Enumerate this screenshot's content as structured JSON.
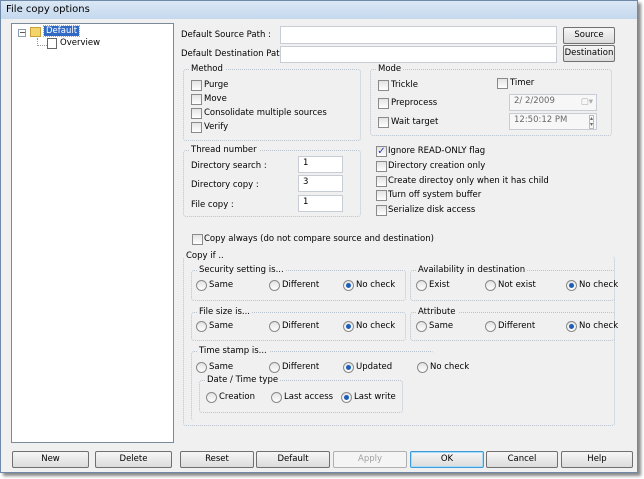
{
  "window": {
    "title": "File copy options"
  },
  "tree": {
    "root": "Default",
    "child": "Overview"
  },
  "paths": {
    "source_label": "Default Source Path :",
    "source_value": "",
    "source_button": "Source",
    "dest_label": "Default Destination Path :",
    "dest_value": "",
    "dest_button": "Destination"
  },
  "method": {
    "title": "Method",
    "items": [
      {
        "label": "Purge",
        "checked": false
      },
      {
        "label": "Move",
        "checked": false
      },
      {
        "label": "Consolidate multiple sources",
        "checked": false
      },
      {
        "label": "Verify",
        "checked": false
      }
    ]
  },
  "mode": {
    "title": "Mode",
    "trickle": "Trickle",
    "preprocess": "Preprocess",
    "wait_target": "Wait target",
    "timer": "Timer",
    "date": "2/ 2/2009",
    "time": "12:50:12 PM"
  },
  "thread": {
    "title": "Thread number",
    "directory_search_label": "Directory search :",
    "directory_search": "1",
    "directory_copy_label": "Directory copy :",
    "directory_copy": "3",
    "file_copy_label": "File copy :",
    "file_copy": "1"
  },
  "options": [
    {
      "label": "Ignore READ-ONLY flag",
      "checked": true
    },
    {
      "label": "Directory creation only",
      "checked": false
    },
    {
      "label": "Create directoy only when it has child",
      "checked": false
    },
    {
      "label": "Turn off system buffer",
      "checked": false
    },
    {
      "label": "Serialize disk access",
      "checked": false
    }
  ],
  "copy_always": {
    "label": "Copy always (do not compare source and destination)",
    "checked": false
  },
  "copy_if": {
    "title": "Copy if ..",
    "security": {
      "title": "Security setting is...",
      "options": [
        "Same",
        "Different",
        "No check"
      ],
      "selected": "No check"
    },
    "availability": {
      "title": "Availability in destination",
      "options": [
        "Exist",
        "Not exist",
        "No check"
      ],
      "selected": "No check"
    },
    "file_size": {
      "title": "File size is...",
      "options": [
        "Same",
        "Different",
        "No check"
      ],
      "selected": "No check"
    },
    "attribute": {
      "title": "Attribute",
      "options": [
        "Same",
        "Different",
        "No check"
      ],
      "selected": "No check"
    },
    "timestamp": {
      "title": "Time stamp is...",
      "options": [
        "Same",
        "Different",
        "Updated",
        "No check"
      ],
      "selected": "Updated"
    },
    "datetime_type": {
      "title": "Date / Time type",
      "options": [
        "Creation",
        "Last access",
        "Last write"
      ],
      "selected": "Last write"
    }
  },
  "buttons": {
    "new": "New",
    "delete": "Delete",
    "reset": "Reset",
    "default": "Default",
    "apply": "Apply",
    "ok": "OK",
    "cancel": "Cancel",
    "help": "Help"
  },
  "colors": {
    "accent": "#3c9bd8",
    "selection": "#316ac5"
  }
}
